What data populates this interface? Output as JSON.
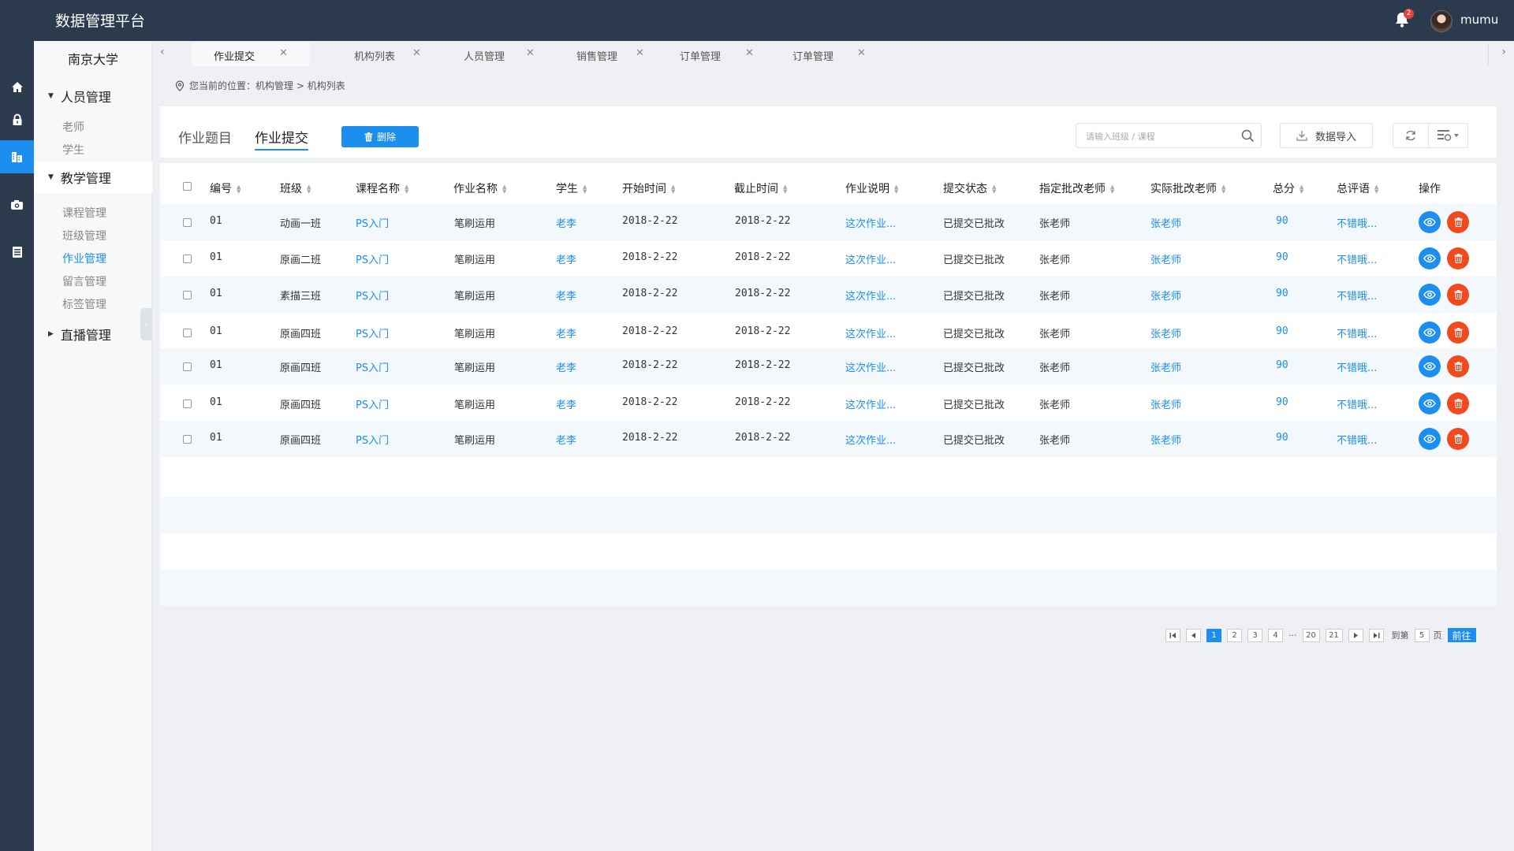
{
  "app": {
    "title": "数据管理平台"
  },
  "header": {
    "notification_count": "2",
    "username": "mumu"
  },
  "icon_bar": [
    {
      "icon": "home-icon"
    },
    {
      "icon": "lock-icon"
    },
    {
      "icon": "building-icon",
      "active": true
    },
    {
      "icon": "camera-icon"
    },
    {
      "icon": "document-icon"
    }
  ],
  "sidebar": {
    "school": "南京大学",
    "groups": [
      {
        "label": "人员管理",
        "expanded": true,
        "items": [
          "老师",
          "学生"
        ]
      },
      {
        "label": "教学管理",
        "expanded": true,
        "active": true,
        "items": [
          "课程管理",
          "班级管理",
          "作业管理",
          "留言管理",
          "标签管理"
        ],
        "active_item": "作业管理"
      },
      {
        "label": "直播管理",
        "expanded": false,
        "items": []
      }
    ]
  },
  "tabs": [
    {
      "label": "作业提交",
      "active": true
    },
    {
      "label": "机构列表"
    },
    {
      "label": "人员管理"
    },
    {
      "label": "销售管理"
    },
    {
      "label": "订单管理"
    },
    {
      "label": "订单管理"
    }
  ],
  "breadcrumb": {
    "prefix": "您当前的位置：",
    "path": "机构管理 > 机构列表"
  },
  "toolbar": {
    "tab1": "作业题目",
    "tab2": "作业提交",
    "delete_label": "删除",
    "search_placeholder": "请输入班级 / 课程",
    "import_label": "数据导入"
  },
  "table": {
    "columns": [
      "编号",
      "班级",
      "课程名称",
      "作业名称",
      "学生",
      "开始时间",
      "截止时间",
      "作业说明",
      "提交状态",
      "指定批改老师",
      "实际批改老师",
      "总分",
      "总评语",
      "操作"
    ],
    "rows": [
      [
        "01",
        "动画一班",
        "PS入门",
        "笔刷运用",
        "老李",
        "2018-2-22",
        "2018-2-22",
        "这次作业...",
        "已提交已批改",
        "张老师",
        "张老师",
        "90",
        "不错哦..."
      ],
      [
        "01",
        "原画二班",
        "PS入门",
        "笔刷运用",
        "老李",
        "2018-2-22",
        "2018-2-22",
        "这次作业...",
        "已提交已批改",
        "张老师",
        "张老师",
        "90",
        "不错哦..."
      ],
      [
        "01",
        "素描三班",
        "PS入门",
        "笔刷运用",
        "老李",
        "2018-2-22",
        "2018-2-22",
        "这次作业...",
        "已提交已批改",
        "张老师",
        "张老师",
        "90",
        "不错哦..."
      ],
      [
        "01",
        "原画四班",
        "PS入门",
        "笔刷运用",
        "老李",
        "2018-2-22",
        "2018-2-22",
        "这次作业...",
        "已提交已批改",
        "张老师",
        "张老师",
        "90",
        "不错哦..."
      ],
      [
        "01",
        "原画四班",
        "PS入门",
        "笔刷运用",
        "老李",
        "2018-2-22",
        "2018-2-22",
        "这次作业...",
        "已提交已批改",
        "张老师",
        "张老师",
        "90",
        "不错哦..."
      ],
      [
        "01",
        "原画四班",
        "PS入门",
        "笔刷运用",
        "老李",
        "2018-2-22",
        "2018-2-22",
        "这次作业...",
        "已提交已批改",
        "张老师",
        "张老师",
        "90",
        "不错哦..."
      ],
      [
        "01",
        "原画四班",
        "PS入门",
        "笔刷运用",
        "老李",
        "2018-2-22",
        "2018-2-22",
        "这次作业...",
        "已提交已批改",
        "张老师",
        "张老师",
        "90",
        "不错哦..."
      ]
    ]
  },
  "pagination": {
    "pages": [
      "1",
      "2",
      "3",
      "4"
    ],
    "ellipsis": "···",
    "last_pages": [
      "20",
      "21"
    ],
    "current": "1",
    "goto_label": "到第",
    "goto_value": "5",
    "page_unit": "页",
    "go_button": "前往"
  },
  "colors": {
    "primary": "#1b8ef0",
    "danger": "#f04a1e",
    "topbar": "#2b3a4d",
    "row_alt": "#f3f8fd"
  }
}
